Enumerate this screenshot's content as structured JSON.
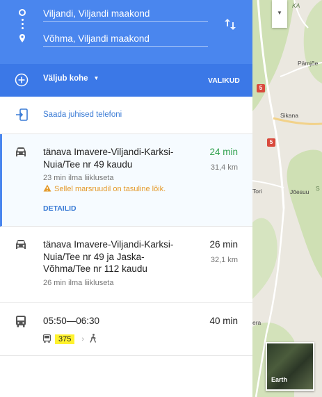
{
  "route_inputs": {
    "from": "Viljandi, Viljandi maakond",
    "to": "Võhma, Viljandi maakond"
  },
  "options": {
    "depart_label": "Väljub kohe",
    "options_label": "VALIKUD"
  },
  "send": {
    "label": "Saada juhised telefoni"
  },
  "routes": [
    {
      "title": "tänava Imavere-Viljandi-Karksi-Nuia/Tee nr 49 kaudu",
      "time": "24 min",
      "distance": "31,4 km",
      "note": "23 min ilma liikluseta",
      "warning": "Sellel marsruudil on tasuline lõik.",
      "details_label": "DETAILID"
    },
    {
      "title": "tänava Imavere-Viljandi-Karksi-Nuia/Tee nr 49 ja Jaska-Võhma/Tee nr 112 kaudu",
      "time": "26 min",
      "distance": "32,1 km",
      "note": "26 min ilma liikluseta"
    },
    {
      "title": "05:50—06:30",
      "time": "40 min",
      "line": "375"
    }
  ],
  "map": {
    "labels": {
      "ka": "KA",
      "parnjoe": "Pärnjõe",
      "sikana": "Sikana",
      "tori": "Tori",
      "joesuu": "Jõesuu",
      "s": "S",
      "era": "era"
    },
    "shields": [
      "5",
      "5"
    ],
    "earth_label": "Earth"
  },
  "colors": {
    "header": "#4a86ee",
    "options_bar": "#3b78e7",
    "link": "#3a7bd5",
    "fast_time": "#31a14f",
    "warning": "#e49a2b",
    "line_badge": "#fff22e"
  }
}
